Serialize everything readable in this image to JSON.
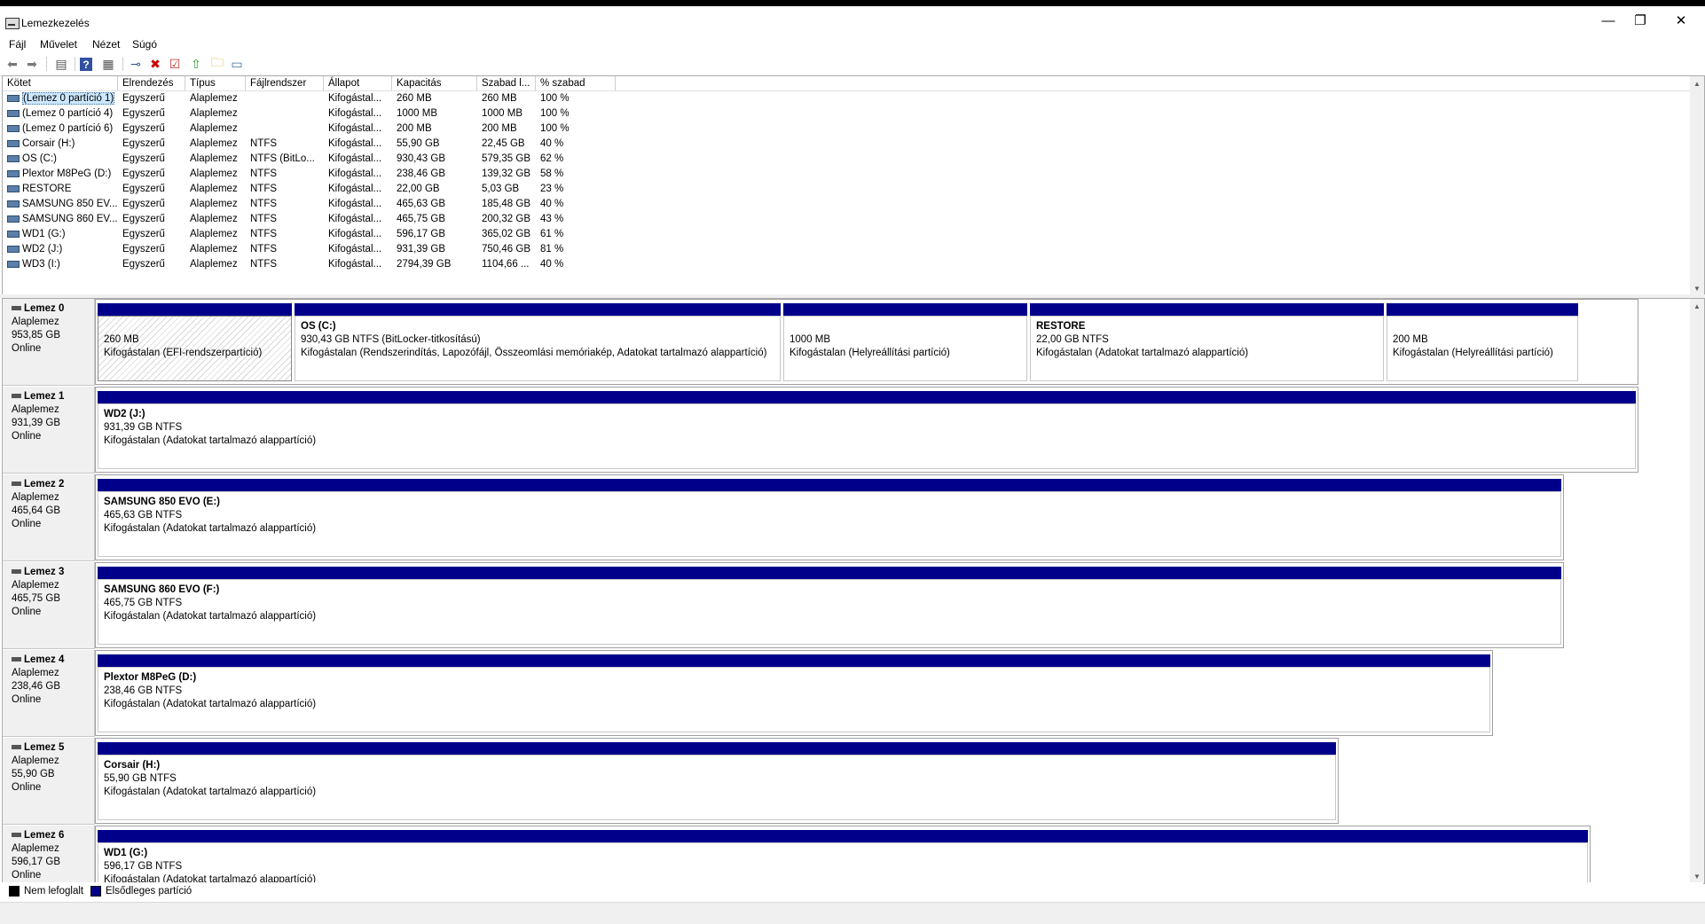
{
  "window": {
    "title": "Lemezkezelés",
    "minimize_glyph": "—",
    "maximize_glyph": "❐",
    "close_glyph": "✕"
  },
  "menu": [
    "Fájl",
    "Művelet",
    "Nézet",
    "Súgó"
  ],
  "toolbar_icons": [
    "back-icon",
    "forward-icon",
    "show-hide-console-tree-icon",
    "help-icon",
    "console-window-icon",
    "connect-virtual-disk-icon",
    "delete-icon",
    "checklist-icon",
    "move-up-icon",
    "folder-properties-icon",
    "volume-list-icon"
  ],
  "volume_list": {
    "headers": [
      "Kötet",
      "Elrendezés",
      "Típus",
      "Fájlrendszer",
      "Állapot",
      "Kapacitás",
      "Szabad l...",
      "% szabad"
    ],
    "rows": [
      [
        "(Lemez 0 partíció 1)",
        "Egyszerű",
        "Alaplemez",
        "",
        "Kifogástal...",
        "260 MB",
        "260 MB",
        "100 %"
      ],
      [
        "(Lemez 0 partíció 4)",
        "Egyszerű",
        "Alaplemez",
        "",
        "Kifogástal...",
        "1000 MB",
        "1000 MB",
        "100 %"
      ],
      [
        "(Lemez 0 partíció 6)",
        "Egyszerű",
        "Alaplemez",
        "",
        "Kifogástal...",
        "200 MB",
        "200 MB",
        "100 %"
      ],
      [
        "Corsair (H:)",
        "Egyszerű",
        "Alaplemez",
        "NTFS",
        "Kifogástal...",
        "55,90 GB",
        "22,45 GB",
        "40 %"
      ],
      [
        "OS (C:)",
        "Egyszerű",
        "Alaplemez",
        "NTFS (BitLo...",
        "Kifogástal...",
        "930,43 GB",
        "579,35 GB",
        "62 %"
      ],
      [
        "Plextor M8PeG (D:)",
        "Egyszerű",
        "Alaplemez",
        "NTFS",
        "Kifogástal...",
        "238,46 GB",
        "139,32 GB",
        "58 %"
      ],
      [
        "RESTORE",
        "Egyszerű",
        "Alaplemez",
        "NTFS",
        "Kifogástal...",
        "22,00 GB",
        "5,03 GB",
        "23 %"
      ],
      [
        "SAMSUNG 850 EV...",
        "Egyszerű",
        "Alaplemez",
        "NTFS",
        "Kifogástal...",
        "465,63 GB",
        "185,48 GB",
        "40 %"
      ],
      [
        "SAMSUNG 860 EV...",
        "Egyszerű",
        "Alaplemez",
        "NTFS",
        "Kifogástal...",
        "465,75 GB",
        "200,32 GB",
        "43 %"
      ],
      [
        "WD1 (G:)",
        "Egyszerű",
        "Alaplemez",
        "NTFS",
        "Kifogástal...",
        "596,17 GB",
        "365,02 GB",
        "61 %"
      ],
      [
        "WD2 (J:)",
        "Egyszerű",
        "Alaplemez",
        "NTFS",
        "Kifogástal...",
        "931,39 GB",
        "750,46 GB",
        "81 %"
      ],
      [
        "WD3 (I:)",
        "Egyszerű",
        "Alaplemez",
        "NTFS",
        "Kifogástal...",
        "2794,39 GB",
        "1104,66 ...",
        "40 %"
      ]
    ]
  },
  "disks": [
    {
      "name": "Lemez 0",
      "type": "Alaplemez",
      "size": "953,85 GB",
      "status": "Online",
      "partitions": [
        {
          "title": "",
          "line1": "260 MB",
          "line2": "Kifogástalan (EFI-rendszerpartíció)",
          "hatched": true
        },
        {
          "title": "OS  (C:)",
          "line1": "930,43 GB NTFS (BitLocker-titkosítású)",
          "line2": "Kifogástalan (Rendszerindítás, Lapozófájl, Összeomlási memóriakép, Adatokat tartalmazó alappartíció)"
        },
        {
          "title": "",
          "line1": "1000 MB",
          "line2": "Kifogástalan (Helyreállítási partíció)"
        },
        {
          "title": "RESTORE",
          "line1": "22,00 GB NTFS",
          "line2": "Kifogástalan (Adatokat tartalmazó alappartíció)"
        },
        {
          "title": "",
          "line1": "200 MB",
          "line2": "Kifogástalan (Helyreállítási partíció)"
        }
      ]
    },
    {
      "name": "Lemez 1",
      "type": "Alaplemez",
      "size": "931,39 GB",
      "status": "Online",
      "partitions": [
        {
          "title": "WD2  (J:)",
          "line1": "931,39 GB NTFS",
          "line2": "Kifogástalan (Adatokat tartalmazó alappartíció)"
        }
      ]
    },
    {
      "name": "Lemez 2",
      "type": "Alaplemez",
      "size": "465,64 GB",
      "status": "Online",
      "partitions": [
        {
          "title": "SAMSUNG 850 EVO  (E:)",
          "line1": "465,63 GB NTFS",
          "line2": "Kifogástalan (Adatokat tartalmazó alappartíció)"
        }
      ]
    },
    {
      "name": "Lemez 3",
      "type": "Alaplemez",
      "size": "465,75 GB",
      "status": "Online",
      "partitions": [
        {
          "title": "SAMSUNG 860 EVO  (F:)",
          "line1": "465,75 GB NTFS",
          "line2": "Kifogástalan (Adatokat tartalmazó alappartíció)"
        }
      ]
    },
    {
      "name": "Lemez 4",
      "type": "Alaplemez",
      "size": "238,46 GB",
      "status": "Online",
      "partitions": [
        {
          "title": "Plextor M8PeG  (D:)",
          "line1": "238,46 GB NTFS",
          "line2": "Kifogástalan (Adatokat tartalmazó alappartíció)"
        }
      ]
    },
    {
      "name": "Lemez 5",
      "type": "Alaplemez",
      "size": "55,90 GB",
      "status": "Online",
      "partitions": [
        {
          "title": "Corsair  (H:)",
          "line1": "55,90 GB NTFS",
          "line2": "Kifogástalan (Adatokat tartalmazó alappartíció)"
        }
      ]
    },
    {
      "name": "Lemez 6",
      "type": "Alaplemez",
      "size": "596,17 GB",
      "status": "Online",
      "partitions": [
        {
          "title": "WD1  (G:)",
          "line1": "596,17 GB NTFS",
          "line2": "Kifogástalan (Adatokat tartalmazó alappartíció)"
        }
      ]
    }
  ],
  "legend": [
    {
      "label": "Nem lefoglalt",
      "color": "#000000"
    },
    {
      "label": "Elsődleges partíció",
      "color": "#00008b"
    }
  ],
  "colors": {
    "primary_partition": "#00008b",
    "unallocated": "#000000",
    "selection": "#cce8ff"
  }
}
